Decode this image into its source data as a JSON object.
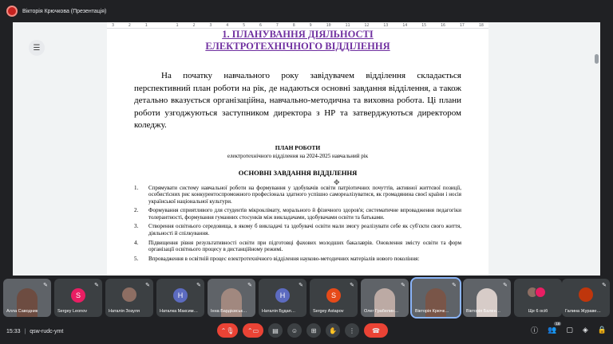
{
  "presenter": {
    "name": "Вікторія Крючкова (Презентація)"
  },
  "ruler": {
    "ticks": [
      "3",
      "2",
      "1",
      "",
      "1",
      "2",
      "3",
      "4",
      "5",
      "6",
      "7",
      "8",
      "9",
      "10",
      "11",
      "12",
      "13",
      "14",
      "15",
      "16",
      "17",
      "18"
    ]
  },
  "document": {
    "heading_line1": "1.      ПЛАНУВАННЯ ДІЯЛЬНОСТІ",
    "heading_line2": "ЕЛЕКТРОТЕХНІЧНОГО ВІДДІЛЕННЯ",
    "intro": "На початку навчального року завідувачем відділення складається перспективний план роботи на рік, де надаються основні завдання відділення, а також детально вказується організаційна, навчально-методична та виховна робота. Ці плани роботи узгоджуються заступником директора з НР та затверджуються директором коледжу.",
    "plan_title": "ПЛАН РОБОТИ",
    "plan_subtitle": "електротехнічного відділення на 2024-2025 навчальний рік",
    "tasks_title": "ОСНОВНІ ЗАВДАННЯ ВІДДІЛЕННЯ",
    "tasks": [
      {
        "num": "1.",
        "text": "Спрямувати систему навчальної роботи на формування у здобувачів освіти патріотичних почуттів, активної життєвої позиції, особистісних рис конкурентоспроможного професіонала здатного успішно самореалізуватися, як громадянина своєї країни і носія української національної культури."
      },
      {
        "num": "2.",
        "text": "Формування сприятливого для студентів мікроклімату, морального й фізичного здоров'я; систематичне впровадження педагогіки толерантності, формування гуманних стосунків між викладачами, здобувачами освіти та батьками."
      },
      {
        "num": "3.",
        "text": "Створення освітнього середовища, в якому б викладачі та здобувачі освіти мали змогу реалізувати себе як суб'єкти свого життя, діяльності й спілкування."
      },
      {
        "num": "4.",
        "text": "Підвищення рівня результативності освіти  при підготовці фахових молодших бакалаврів. Оновлення змісту освіти та форм організації освітнього процесу в дистанційному режимі."
      },
      {
        "num": "5.",
        "text": "Впровадження в освітній процес електротехнічного відділення науково-методичних матеріалів нового покоління:"
      }
    ]
  },
  "participants": [
    {
      "label": "Алла Саводник",
      "kind": "video",
      "color": "#6d4c41"
    },
    {
      "label": "Sergey Leonov",
      "kind": "initial",
      "initial": "S",
      "color": "#e91e63"
    },
    {
      "label": "Наталія Зозуля",
      "kind": "photo",
      "color": "#8d6e63"
    },
    {
      "label": "Наталка Максим…",
      "kind": "initial",
      "initial": "H",
      "color": "#5c6bc0"
    },
    {
      "label": "Інна Бардієвськ…",
      "kind": "video",
      "color": "#a1887f"
    },
    {
      "label": "Наталія Будап…",
      "kind": "initial",
      "initial": "H",
      "color": "#5c6bc0"
    },
    {
      "label": "Sergey Astapov",
      "kind": "initial",
      "initial": "S",
      "color": "#e64a19"
    },
    {
      "label": "Олег Грабелин…",
      "kind": "video",
      "color": "#bcaaa4"
    },
    {
      "label": "Вікторія Крючк…",
      "kind": "video",
      "color": "#795548",
      "active": true
    },
    {
      "label": "Вікторія Бален…",
      "kind": "video",
      "color": "#d7ccc8"
    },
    {
      "label": "Ще 6 осіб",
      "kind": "more",
      "color": "#3c4043"
    },
    {
      "label": "Галина Жураве…",
      "kind": "photo",
      "color": "#bf360c"
    }
  ],
  "bottom": {
    "time": "15:33",
    "separator": "|",
    "meeting_code": "qsw-rudc-ymt",
    "participants_count": "18"
  }
}
